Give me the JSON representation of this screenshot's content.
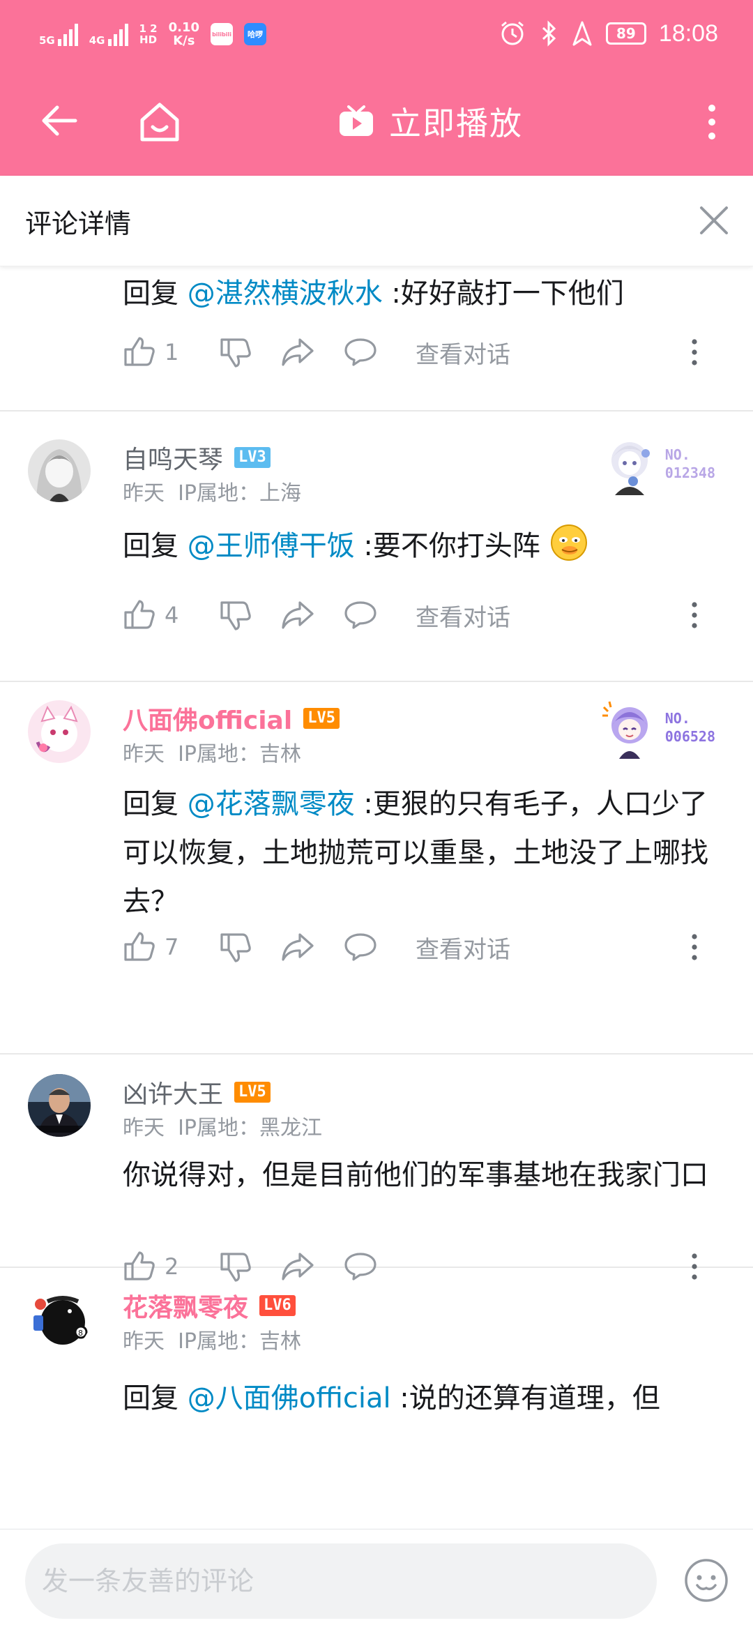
{
  "status_bar": {
    "net1": "5G",
    "net2": "4G",
    "hd_top": "1 2",
    "hd_bottom": "HD",
    "speed_value": "0.10",
    "speed_unit": "K/s",
    "app1_label": "bilibili",
    "app2_label": "哈啰",
    "battery": "89",
    "time": "18:08"
  },
  "app_bar": {
    "title": "立即播放"
  },
  "panel": {
    "title": "评论详情"
  },
  "colors": {
    "brand_pink": "#fb7299",
    "link_blue": "#008ac5",
    "lv3": "#5cbcf0",
    "lv5": "#ff8c00",
    "lv6": "#ff4f3c"
  },
  "comments": [
    {
      "reply_prefix": "回复 ",
      "reply_to": "@湛然横波秋水",
      "text": " :好好敲打一下他们",
      "likes": "1",
      "view_dialog": "查看对话"
    },
    {
      "username": "自鸣天琴",
      "level": "LV3",
      "time": "昨天",
      "ip": "IP属地：上海",
      "card_no_label": "NO.",
      "card_no": "012348",
      "reply_prefix": "回复 ",
      "reply_to": "@王师傅干饭",
      "text": " :要不你打头阵",
      "likes": "4",
      "view_dialog": "查看对话"
    },
    {
      "username": "八面佛official",
      "level": "LV5",
      "time": "昨天",
      "ip": "IP属地：吉林",
      "card_no_label": "NO.",
      "card_no": "006528",
      "reply_prefix": "回复 ",
      "reply_to": "@花落飘零夜",
      "text": " :更狠的只有毛子，人口少了可以恢复，土地抛荒可以重垦，土地没了上哪找去？",
      "likes": "7",
      "view_dialog": "查看对话"
    },
    {
      "username": "凶许大王",
      "level": "LV5",
      "time": "昨天",
      "ip": "IP属地：黑龙江",
      "text": "你说得对，但是目前他们的军事基地在我家门口",
      "likes": "2"
    },
    {
      "username": "花落飘零夜",
      "level": "LV6",
      "time": "昨天",
      "ip": "IP属地：吉林",
      "reply_prefix": "回复 ",
      "reply_to": "@八面佛official",
      "text": " :说的还算有道理，但"
    }
  ],
  "input": {
    "placeholder": "发一条友善的评论"
  }
}
